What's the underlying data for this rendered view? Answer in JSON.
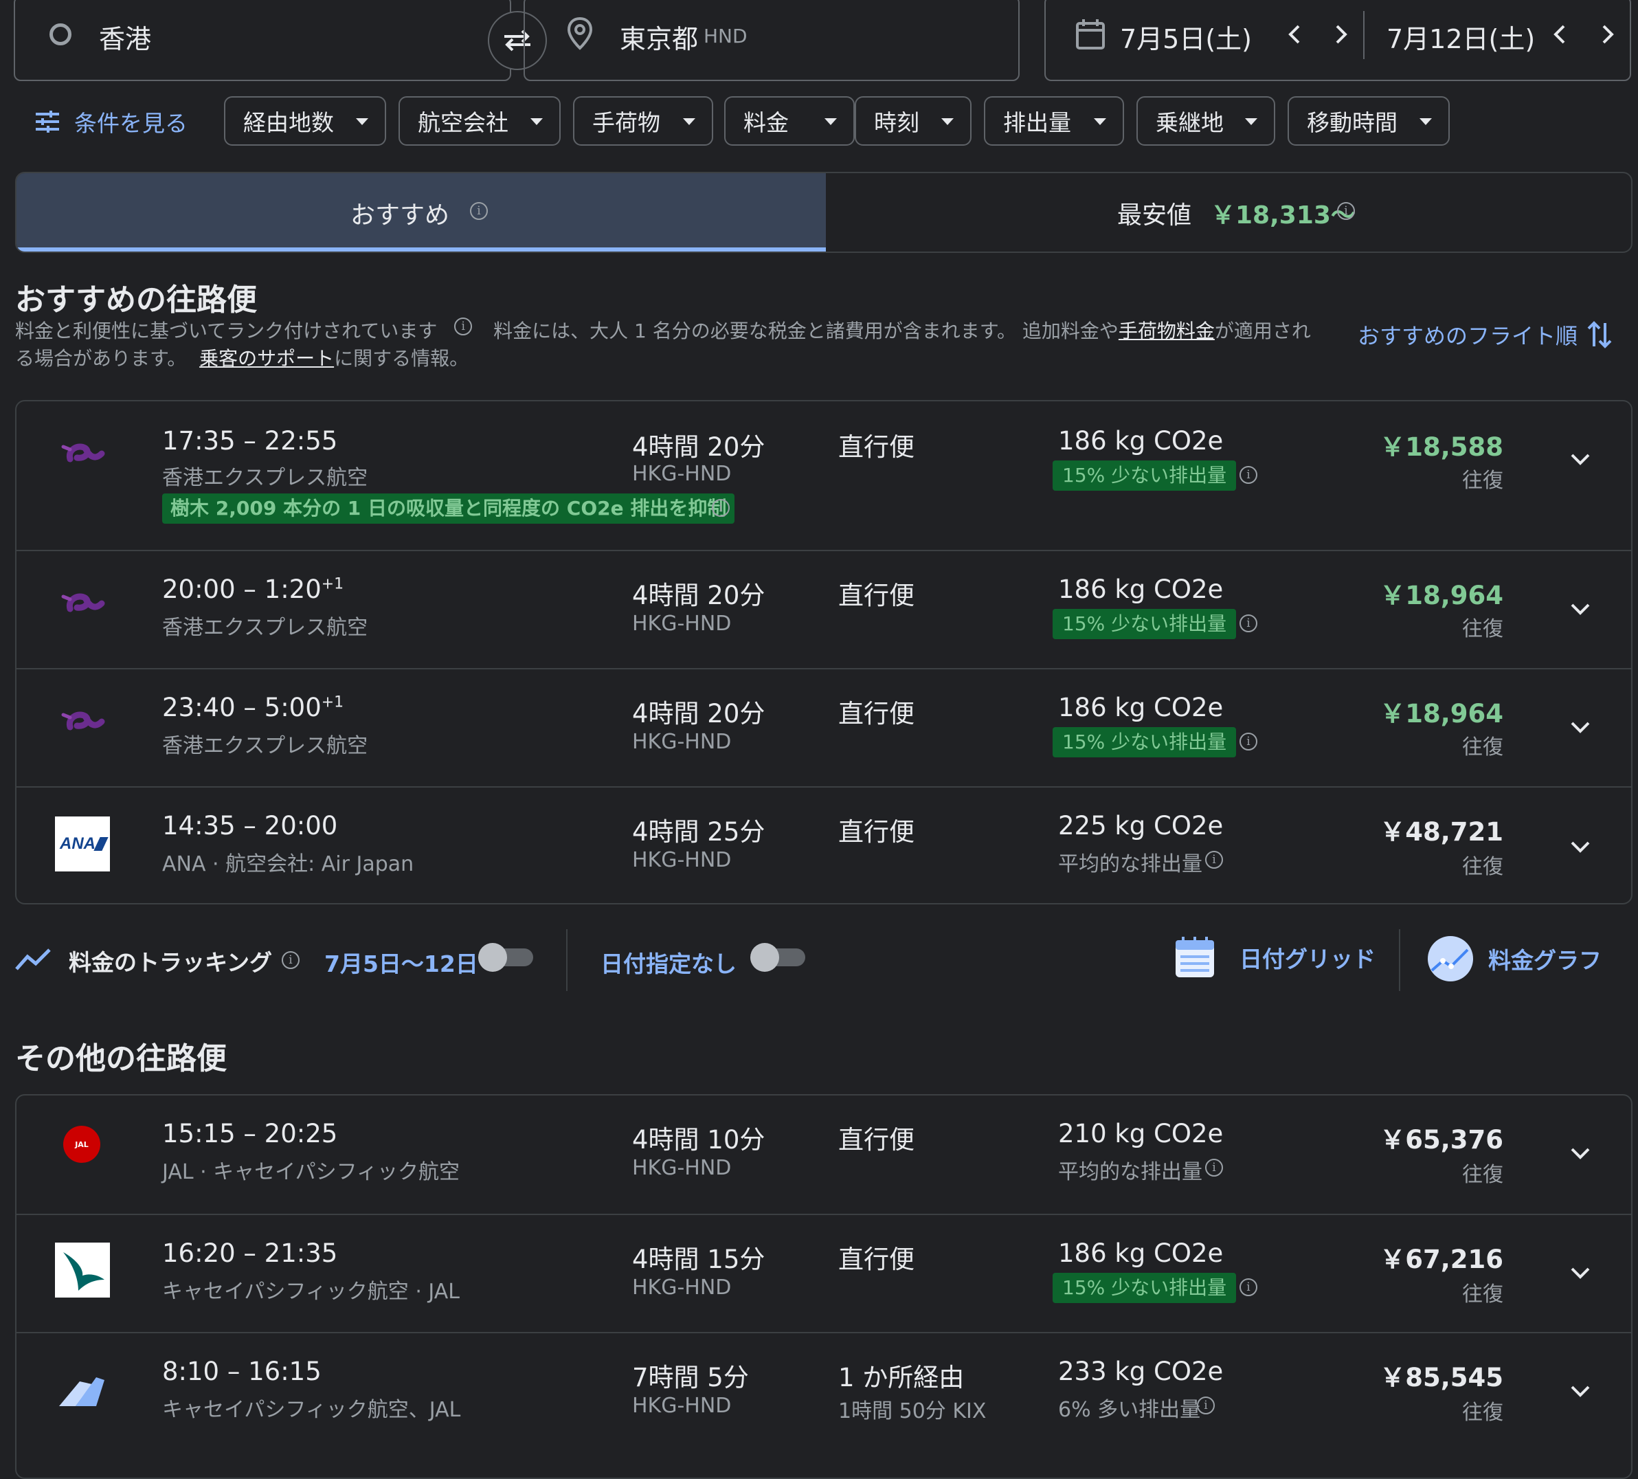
{
  "search": {
    "origin": "香港",
    "destination": "東京都",
    "destination_code": "HND",
    "depart_date": "7月5日(土)",
    "return_date": "7月12日(土)"
  },
  "filters": {
    "all_label": "条件を見る",
    "chips": [
      "経由地数",
      "航空会社",
      "手荷物",
      "料金",
      "時刻",
      "排出量",
      "乗継地",
      "移動時間"
    ]
  },
  "tabs": {
    "recommended": "おすすめ",
    "cheapest_label": "最安値",
    "cheapest_price": "￥18,313～"
  },
  "recommended_section": {
    "title": "おすすめの往路便",
    "desc_part1": "料金と利便性に基づいてランク付けされています",
    "desc_part2": "料金には、大人 1 名分の必要な税金と諸費用が含まれます。 追加料金や",
    "baggage_link": "手荷物料金",
    "desc_part3": "が適用され",
    "desc_part4": "る場合があります。",
    "support_link": "乗客のサポート",
    "desc_part5": "に関する情報。",
    "sort_label": "おすすめのフライト順"
  },
  "recommended_flights": [
    {
      "times": "17:35 – 22:55",
      "next_day": "",
      "airline": "香港エクスプレス航空",
      "duration": "4時間 20分",
      "route": "HKG-HND",
      "stops": "直行便",
      "stop_detail": "",
      "co2": "186 kg CO2e",
      "co2_note": "15% 少ない排出量",
      "co2_badge": true,
      "price": "￥18,588",
      "trip": "往復",
      "price_green": true,
      "tree_note": "樹木 2,009 本分の 1 日の吸収量と同程度の CO2e 排出を抑制"
    },
    {
      "times": "20:00 – 1:20",
      "next_day": "+1",
      "airline": "香港エクスプレス航空",
      "duration": "4時間 20分",
      "route": "HKG-HND",
      "stops": "直行便",
      "stop_detail": "",
      "co2": "186 kg CO2e",
      "co2_note": "15% 少ない排出量",
      "co2_badge": true,
      "price": "￥18,964",
      "trip": "往復",
      "price_green": true
    },
    {
      "times": "23:40 – 5:00",
      "next_day": "+1",
      "airline": "香港エクスプレス航空",
      "duration": "4時間 20分",
      "route": "HKG-HND",
      "stops": "直行便",
      "stop_detail": "",
      "co2": "186 kg CO2e",
      "co2_note": "15% 少ない排出量",
      "co2_badge": true,
      "price": "￥18,964",
      "trip": "往復",
      "price_green": true
    },
    {
      "times": "14:35 – 20:00",
      "next_day": "",
      "airline": "ANA · 航空会社: Air Japan",
      "duration": "4時間 25分",
      "route": "HKG-HND",
      "stops": "直行便",
      "stop_detail": "",
      "co2": "225 kg CO2e",
      "co2_note": "平均的な排出量",
      "co2_badge": false,
      "price": "￥48,721",
      "trip": "往復",
      "price_green": false,
      "logo_text": "ANA"
    }
  ],
  "tracking": {
    "label": "料金のトラッキング",
    "date_range": "7月5日〜12日",
    "any_dates": "日付指定なし",
    "date_grid": "日付グリッド",
    "price_graph": "料金グラフ"
  },
  "other_section": {
    "title": "その他の往路便"
  },
  "other_flights": [
    {
      "times": "15:15 – 20:25",
      "airline": "JAL · キャセイパシフィック航空",
      "duration": "4時間 10分",
      "route": "HKG-HND",
      "stops": "直行便",
      "stop_detail": "",
      "co2": "210 kg CO2e",
      "co2_note": "平均的な排出量",
      "co2_badge": false,
      "price": "￥65,376",
      "trip": "往復",
      "logo_text": "JAL"
    },
    {
      "times": "16:20 – 21:35",
      "airline": "キャセイパシフィック航空 · JAL",
      "duration": "4時間 15分",
      "route": "HKG-HND",
      "stops": "直行便",
      "stop_detail": "",
      "co2": "186 kg CO2e",
      "co2_note": "15% 少ない排出量",
      "co2_badge": true,
      "price": "￥67,216",
      "trip": "往復"
    },
    {
      "times": "8:10 – 16:15",
      "airline": "キャセイパシフィック航空、JAL",
      "duration": "7時間 5分",
      "route": "HKG-HND",
      "stops": "1 か所経由",
      "stop_detail": "1時間 50分 KIX",
      "co2": "233 kg CO2e",
      "co2_note": "6% 多い排出量",
      "co2_badge": false,
      "price": "￥85,545",
      "trip": "往復"
    }
  ],
  "colors": {
    "background": "#202124",
    "accent_blue": "#8ab4f8",
    "price_green": "#81c995",
    "badge_green_bg": "#0d652d",
    "hk_express_purple": "#6b2d8f",
    "ana_blue": "#13448f",
    "jal_red": "#cc0000",
    "cathay_teal": "#006564"
  }
}
